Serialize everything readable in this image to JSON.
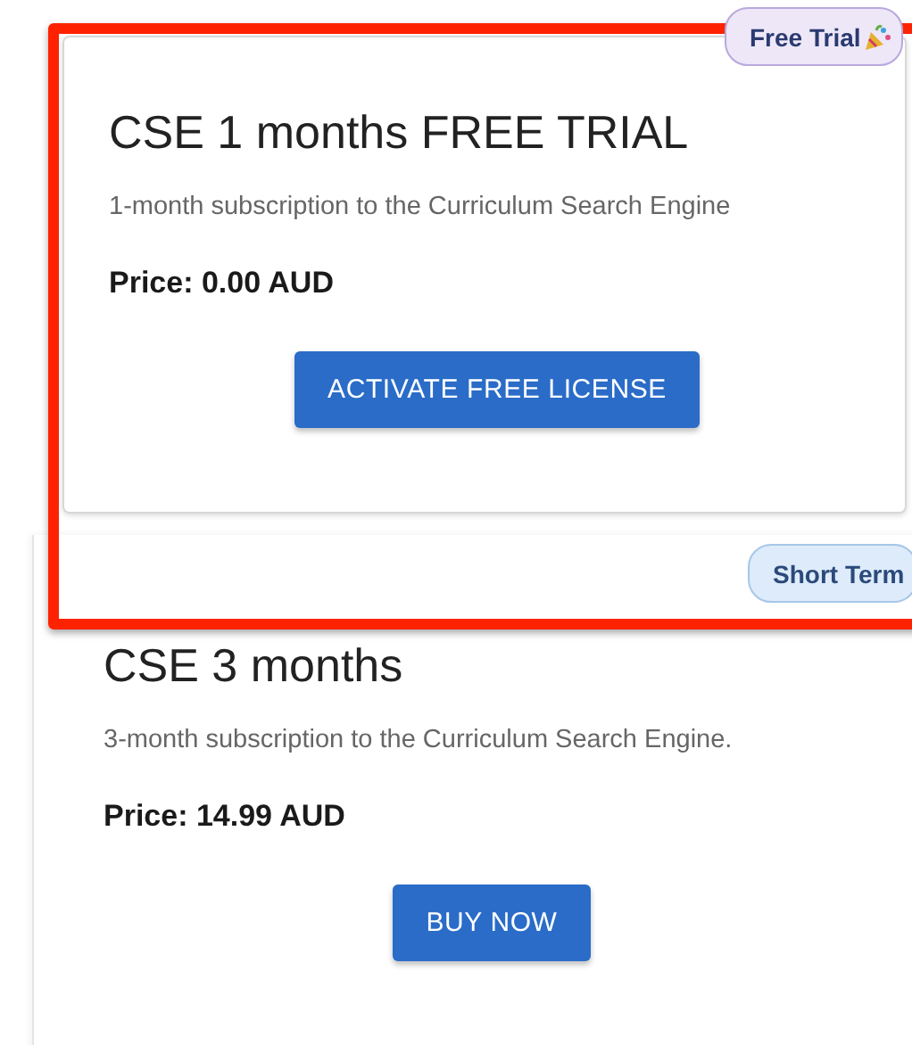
{
  "plans": [
    {
      "title": "CSE 1 months FREE TRIAL",
      "description": "1-month subscription to the Curriculum Search Engine",
      "price": "Price: 0.00 AUD",
      "button": "ACTIVATE FREE LICENSE",
      "badge": {
        "label": "Free Trial",
        "kind": "trial"
      }
    },
    {
      "title": "CSE 3 months",
      "description": "3-month subscription to the Curriculum Search Engine.",
      "price": "Price: 14.99 AUD",
      "button": "BUY NOW",
      "badge": {
        "label": "Short Term",
        "kind": "term"
      }
    }
  ]
}
